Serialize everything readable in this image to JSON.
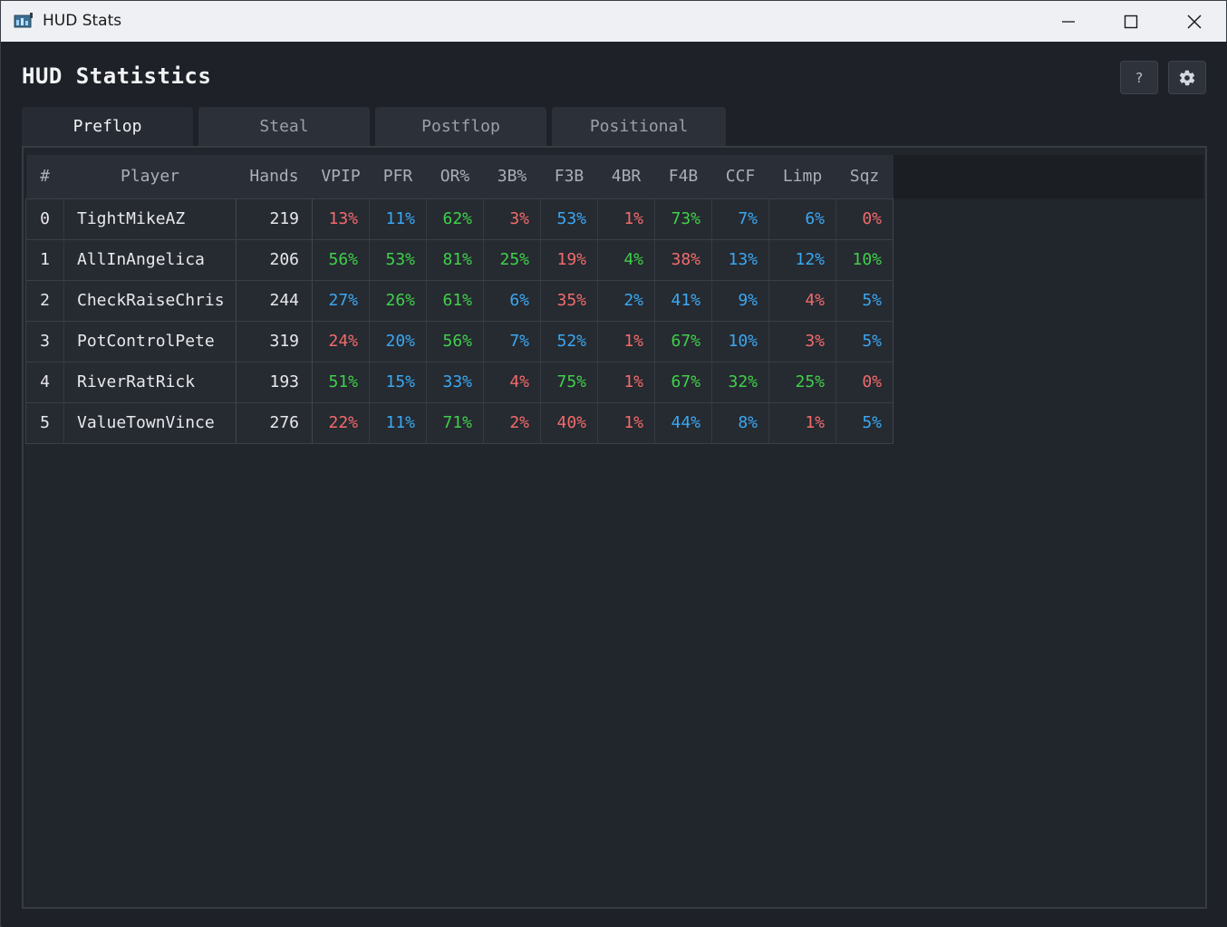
{
  "window": {
    "title": "HUD Stats"
  },
  "page": {
    "title": "HUD Statistics",
    "help_label": "?"
  },
  "tabs": [
    {
      "label": "Preflop",
      "active": true
    },
    {
      "label": "Steal",
      "active": false
    },
    {
      "label": "Postflop",
      "active": false
    },
    {
      "label": "Positional",
      "active": false
    }
  ],
  "colors": {
    "red": "#f26b6b",
    "green": "#3fd04a",
    "blue": "#3aa8f2",
    "background": "#1e2128"
  },
  "table": {
    "columns": [
      "#",
      "Player",
      "Hands",
      "VPIP",
      "PFR",
      "OR%",
      "3B%",
      "F3B",
      "4BR",
      "F4B",
      "CCF",
      "Limp",
      "Sqz"
    ],
    "rows": [
      {
        "idx": "0",
        "player": "TightMikeAZ",
        "hands": "219",
        "stats": [
          {
            "v": "13%",
            "c": "red"
          },
          {
            "v": "11%",
            "c": "blue"
          },
          {
            "v": "62%",
            "c": "green"
          },
          {
            "v": "3%",
            "c": "red"
          },
          {
            "v": "53%",
            "c": "blue"
          },
          {
            "v": "1%",
            "c": "red"
          },
          {
            "v": "73%",
            "c": "green"
          },
          {
            "v": "7%",
            "c": "blue"
          },
          {
            "v": "6%",
            "c": "blue"
          },
          {
            "v": "0%",
            "c": "red"
          }
        ]
      },
      {
        "idx": "1",
        "player": "AllInAngelica",
        "hands": "206",
        "stats": [
          {
            "v": "56%",
            "c": "green"
          },
          {
            "v": "53%",
            "c": "green"
          },
          {
            "v": "81%",
            "c": "green"
          },
          {
            "v": "25%",
            "c": "green"
          },
          {
            "v": "19%",
            "c": "red"
          },
          {
            "v": "4%",
            "c": "green"
          },
          {
            "v": "38%",
            "c": "red"
          },
          {
            "v": "13%",
            "c": "blue"
          },
          {
            "v": "12%",
            "c": "blue"
          },
          {
            "v": "10%",
            "c": "green"
          }
        ]
      },
      {
        "idx": "2",
        "player": "CheckRaiseChris",
        "hands": "244",
        "stats": [
          {
            "v": "27%",
            "c": "blue"
          },
          {
            "v": "26%",
            "c": "green"
          },
          {
            "v": "61%",
            "c": "green"
          },
          {
            "v": "6%",
            "c": "blue"
          },
          {
            "v": "35%",
            "c": "red"
          },
          {
            "v": "2%",
            "c": "blue"
          },
          {
            "v": "41%",
            "c": "blue"
          },
          {
            "v": "9%",
            "c": "blue"
          },
          {
            "v": "4%",
            "c": "red"
          },
          {
            "v": "5%",
            "c": "blue"
          }
        ]
      },
      {
        "idx": "3",
        "player": "PotControlPete",
        "hands": "319",
        "stats": [
          {
            "v": "24%",
            "c": "red"
          },
          {
            "v": "20%",
            "c": "blue"
          },
          {
            "v": "56%",
            "c": "green"
          },
          {
            "v": "7%",
            "c": "blue"
          },
          {
            "v": "52%",
            "c": "blue"
          },
          {
            "v": "1%",
            "c": "red"
          },
          {
            "v": "67%",
            "c": "green"
          },
          {
            "v": "10%",
            "c": "blue"
          },
          {
            "v": "3%",
            "c": "red"
          },
          {
            "v": "5%",
            "c": "blue"
          }
        ]
      },
      {
        "idx": "4",
        "player": "RiverRatRick",
        "hands": "193",
        "stats": [
          {
            "v": "51%",
            "c": "green"
          },
          {
            "v": "15%",
            "c": "blue"
          },
          {
            "v": "33%",
            "c": "blue"
          },
          {
            "v": "4%",
            "c": "red"
          },
          {
            "v": "75%",
            "c": "green"
          },
          {
            "v": "1%",
            "c": "red"
          },
          {
            "v": "67%",
            "c": "green"
          },
          {
            "v": "32%",
            "c": "green"
          },
          {
            "v": "25%",
            "c": "green"
          },
          {
            "v": "0%",
            "c": "red"
          }
        ]
      },
      {
        "idx": "5",
        "player": "ValueTownVince",
        "hands": "276",
        "stats": [
          {
            "v": "22%",
            "c": "red"
          },
          {
            "v": "11%",
            "c": "blue"
          },
          {
            "v": "71%",
            "c": "green"
          },
          {
            "v": "2%",
            "c": "red"
          },
          {
            "v": "40%",
            "c": "red"
          },
          {
            "v": "1%",
            "c": "red"
          },
          {
            "v": "44%",
            "c": "blue"
          },
          {
            "v": "8%",
            "c": "blue"
          },
          {
            "v": "1%",
            "c": "red"
          },
          {
            "v": "5%",
            "c": "blue"
          }
        ]
      }
    ]
  }
}
